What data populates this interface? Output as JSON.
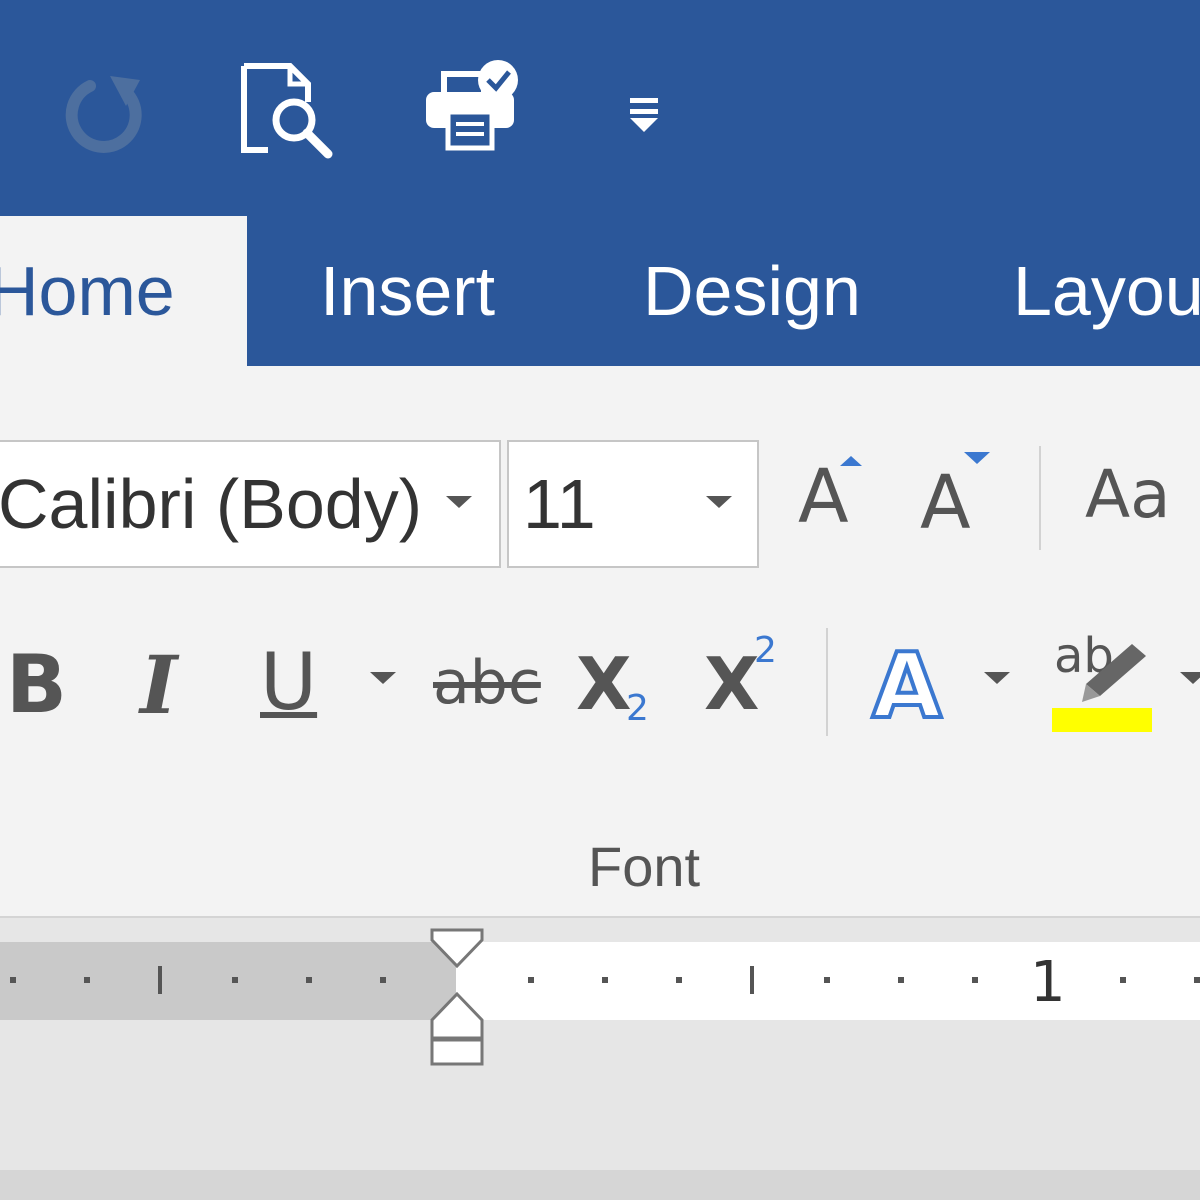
{
  "quick_access": {
    "icons": [
      "redo-icon",
      "print-preview-icon",
      "quick-print-icon",
      "customize-qat-icon"
    ]
  },
  "tabs": [
    {
      "label": "Home",
      "active": true
    },
    {
      "label": "Insert",
      "active": false
    },
    {
      "label": "Design",
      "active": false
    },
    {
      "label": "Layou",
      "active": false
    }
  ],
  "font_group": {
    "font_name": "Calibri (Body)",
    "font_size": "11",
    "grow_font_label": "A",
    "shrink_font_label": "A",
    "change_case_label": "Aa",
    "bold_label": "B",
    "italic_label": "I",
    "underline_label": "U",
    "strikethrough_label": "abc",
    "subscript_base": "X",
    "subscript_index": "2",
    "superscript_base": "X",
    "superscript_index": "2",
    "text_effects_label": "A",
    "highlight_label": "ab",
    "group_label": "Font"
  },
  "ruler": {
    "number_label": "1"
  },
  "colors": {
    "ribbon_blue": "#2b579a",
    "ribbon_bg": "#f3f3f3",
    "highlight_yellow": "#ffff00",
    "accent_blue": "#3b78d0"
  }
}
